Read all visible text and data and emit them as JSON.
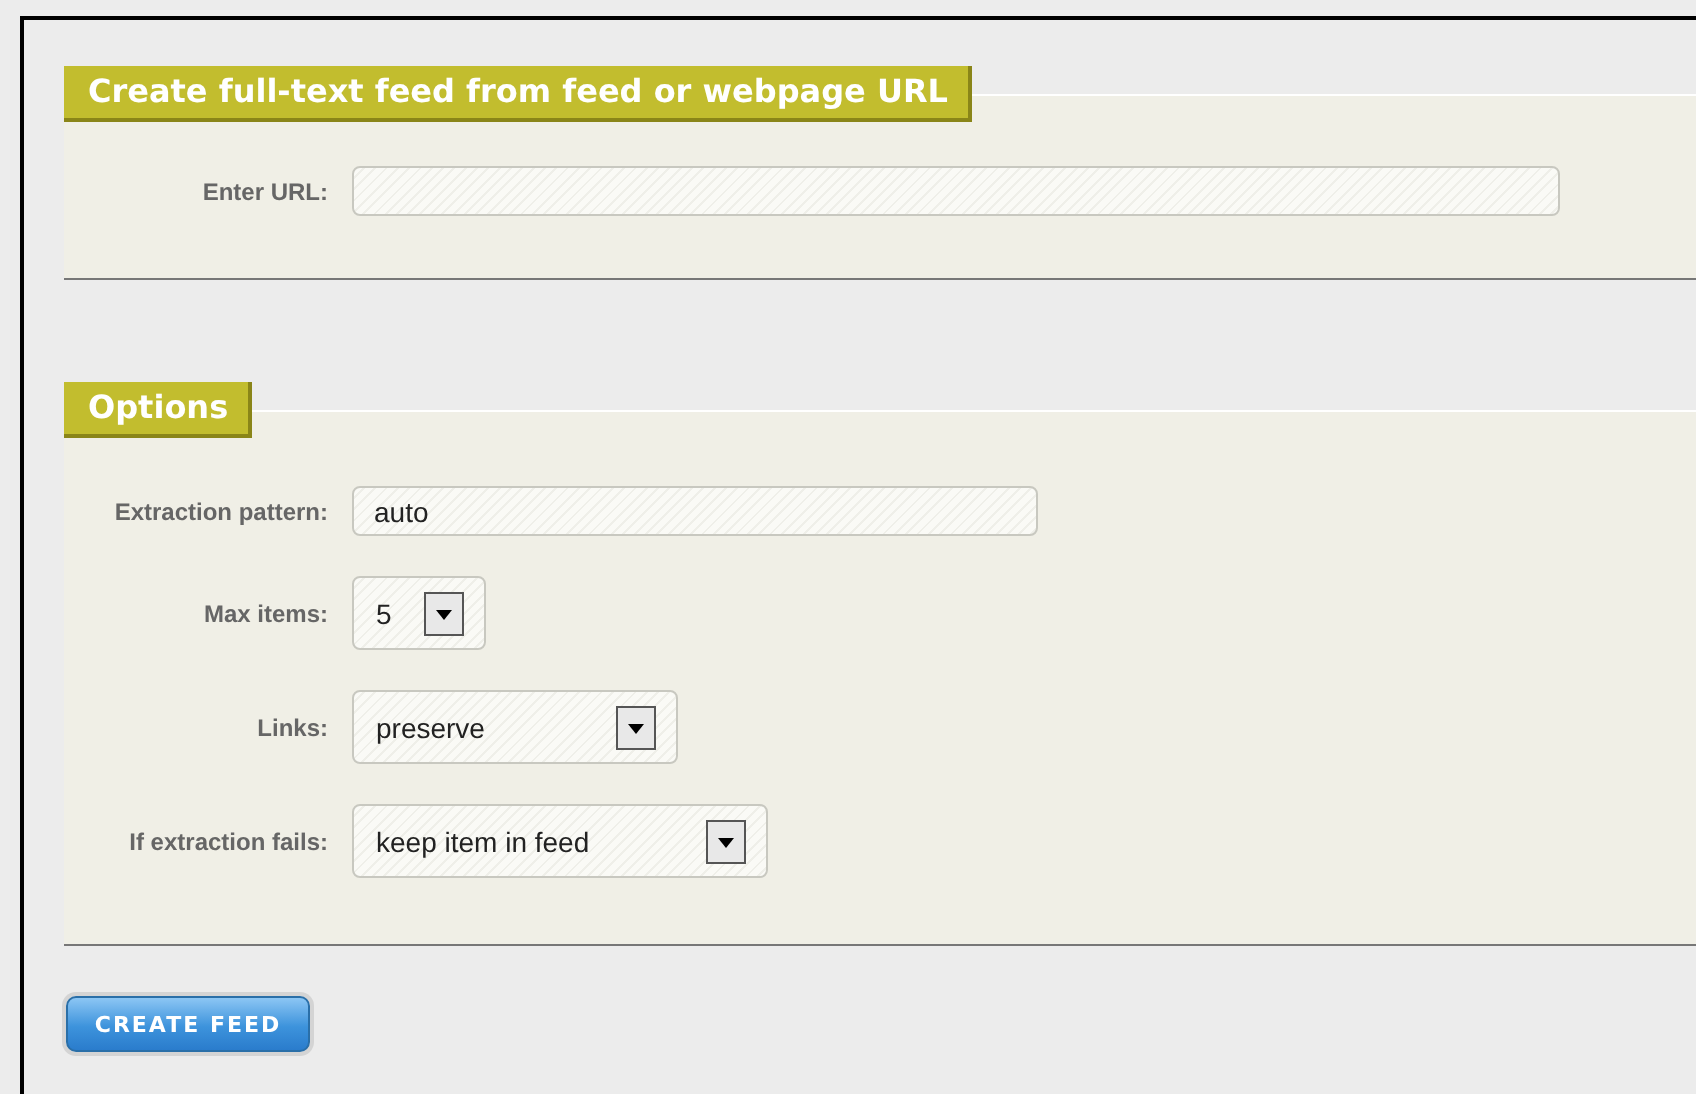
{
  "sections": [
    {
      "legend": "Create full-text feed from feed or webpage URL",
      "fields": [
        {
          "kind": "text",
          "label": "Enter URL:"
        }
      ]
    },
    {
      "legend": "Options",
      "fields": [
        {
          "kind": "text",
          "label": "Extraction pattern:",
          "value": "auto"
        },
        {
          "kind": "select",
          "label": "Max items:",
          "value": "5"
        },
        {
          "kind": "select",
          "label": "Links:",
          "value": "preserve"
        },
        {
          "kind": "select",
          "label": "If extraction fails:",
          "value": "keep item in feed"
        }
      ]
    }
  ],
  "submit": "CREATE FEED"
}
